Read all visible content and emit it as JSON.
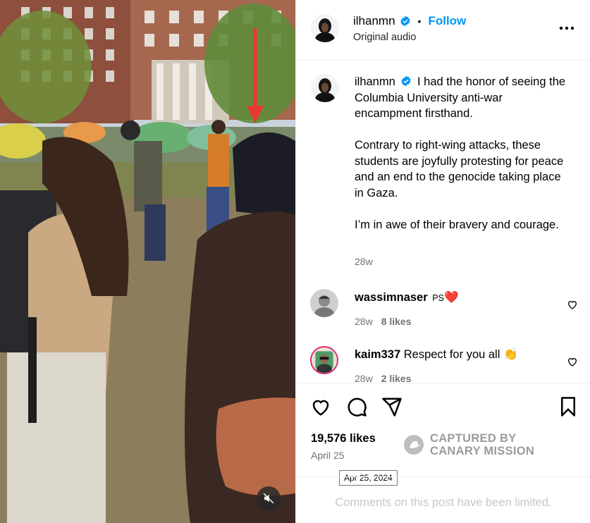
{
  "post": {
    "username": "ilhanmn",
    "follow_label": "Follow",
    "separator": "•",
    "audio_label": "Original audio"
  },
  "caption": {
    "username": "ilhanmn",
    "paragraphs": [
      "I had the honor of seeing the Columbia University anti-war encampment firsthand.",
      "Contrary to right-wing attacks, these students are joyfully protesting for peace and an end to the genocide taking place in Gaza.",
      "I’m in awe of their bravery and courage."
    ],
    "time": "28w"
  },
  "comments": [
    {
      "username": "wassimnaser",
      "text": "PS",
      "emoji": "❤️",
      "time": "28w",
      "likes": "8 likes"
    },
    {
      "username": "kaim337",
      "text": "Respect for you all",
      "emoji": "👏",
      "time": "28w",
      "likes": "2 likes"
    }
  ],
  "actions": {
    "likes": "19,576 likes",
    "date": "April 25",
    "date_tooltip": "Apr 25, 2024",
    "watermark_line1": "CAPTURED BY",
    "watermark_line2": "CANARY MISSION"
  },
  "footer": {
    "limited_text": "Comments on this post have been limited."
  },
  "colors": {
    "accent": "#0095f6",
    "verified": "#0095f6",
    "heart": "#ff3040",
    "muted": "#737373",
    "arrow": "#e8382f"
  },
  "icons": [
    "verified-badge-icon",
    "more-options-icon",
    "heart-icon",
    "comment-icon",
    "share-icon",
    "bookmark-icon",
    "mute-icon",
    "canary-logo-icon"
  ]
}
